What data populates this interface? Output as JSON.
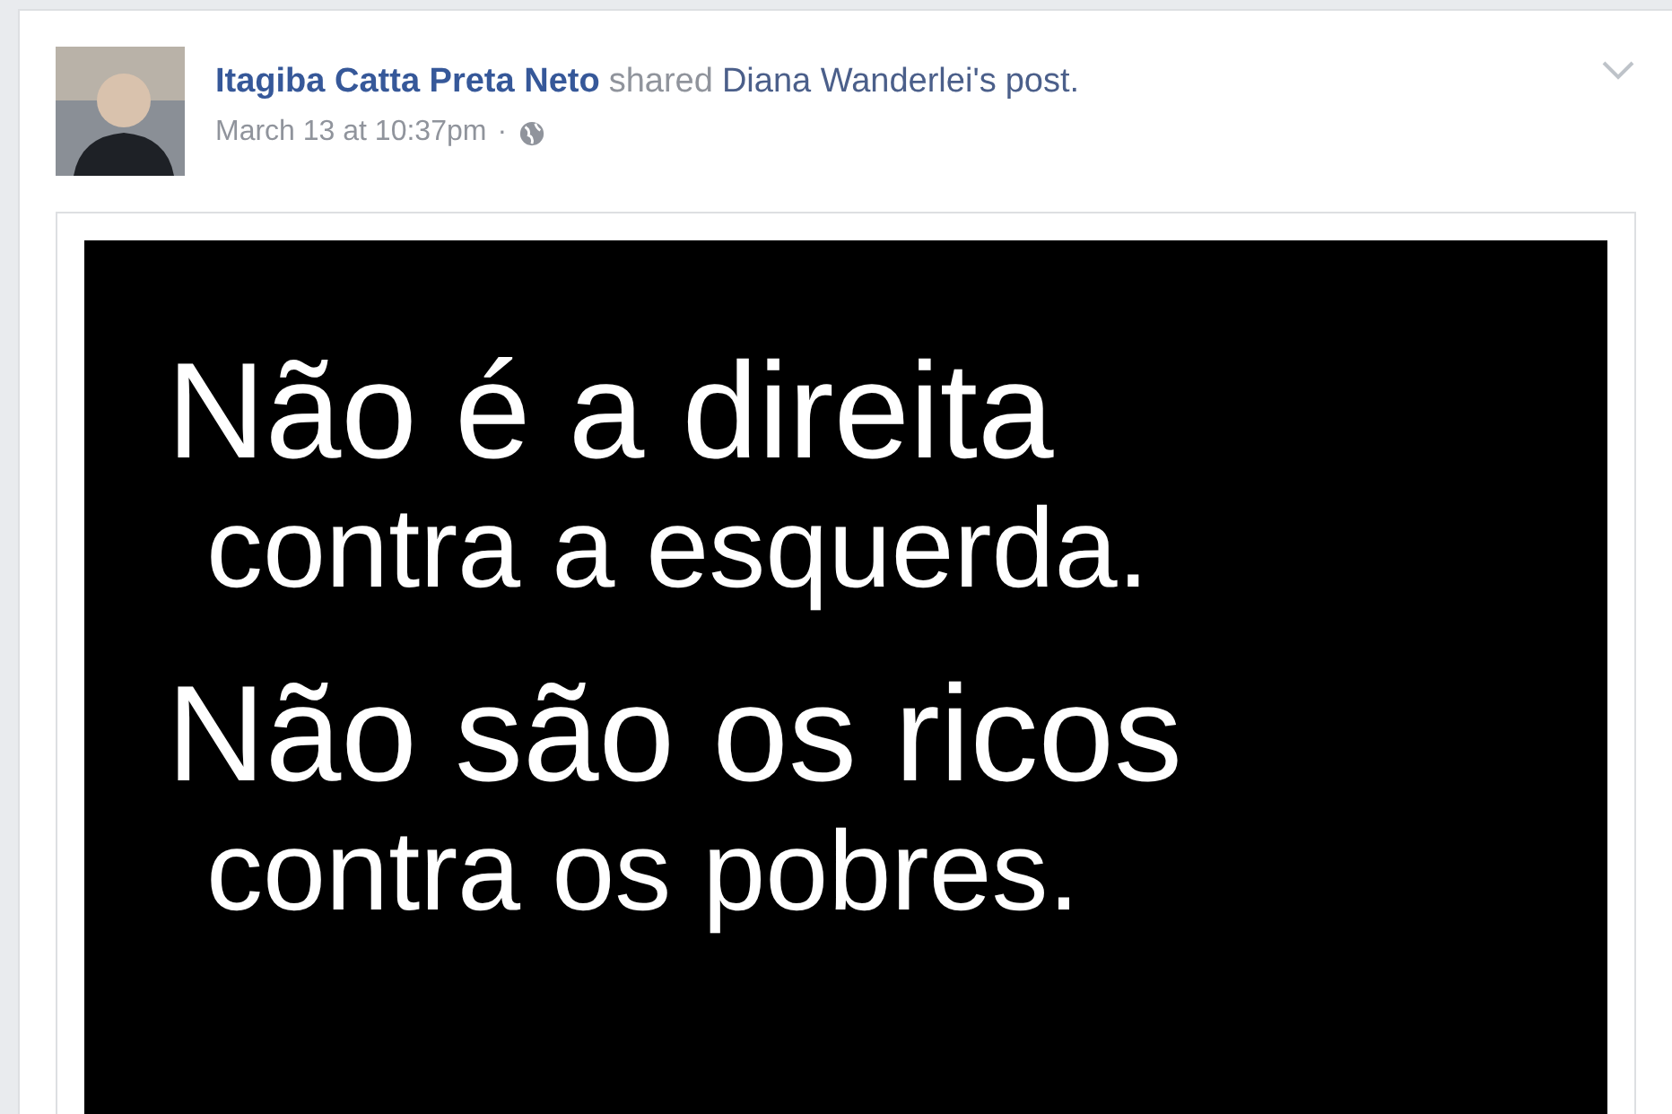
{
  "post": {
    "author": "Itagiba Catta Preta Neto",
    "action": "shared",
    "shared_from": "Diana Wanderlei's",
    "object": "post.",
    "time": "March 13 at 10:37pm",
    "separator": "·"
  },
  "shared_image": {
    "lines": [
      {
        "kind": "headline",
        "text": "Não é a direita"
      },
      {
        "kind": "subline",
        "text": "contra a esquerda."
      },
      {
        "kind": "headline",
        "text": "Não são os ricos"
      },
      {
        "kind": "subline",
        "text": "contra os pobres."
      }
    ]
  }
}
